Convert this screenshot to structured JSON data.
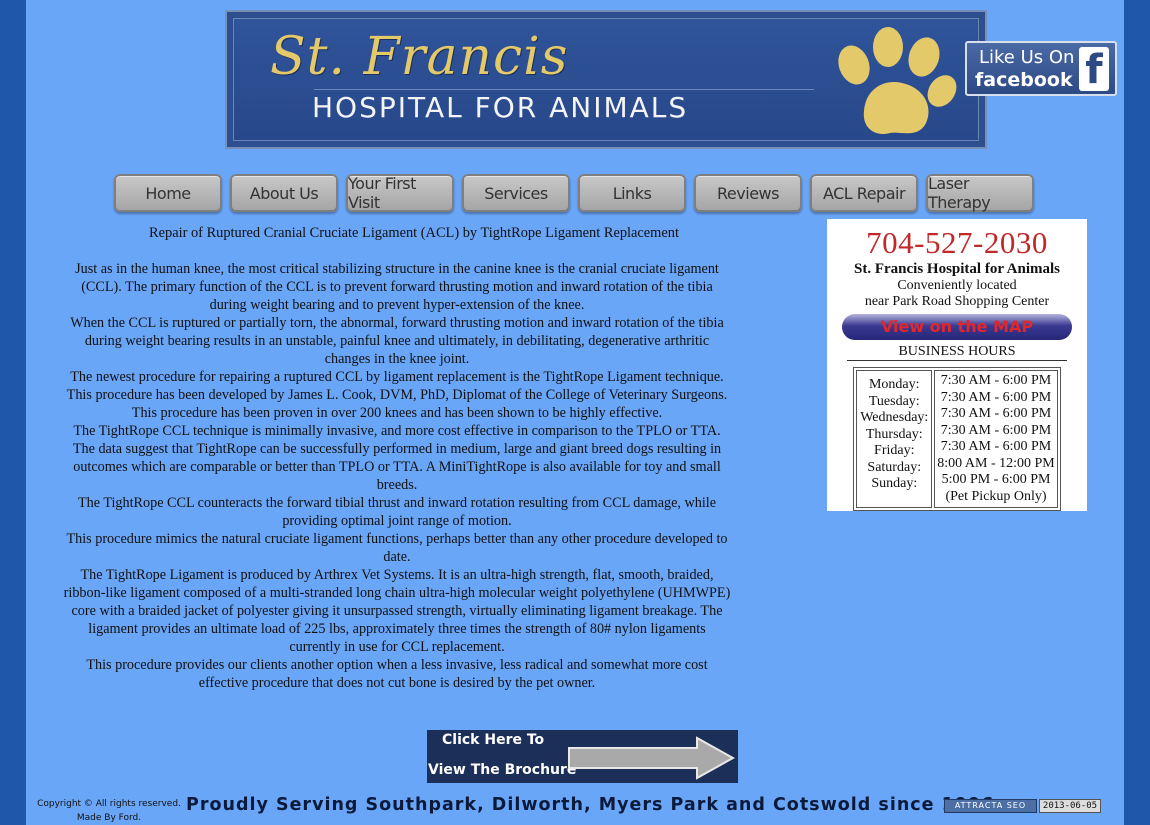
{
  "header": {
    "title": "St. Francis",
    "subtitle": "HOSPITAL FOR ANIMALS",
    "logo_icon": "paw-print-icon",
    "brand_color": "#e4c96a",
    "banner_color": "#2e4f8f"
  },
  "facebook": {
    "line1": "Like Us On",
    "line2": "facebook",
    "icon": "facebook-f-icon"
  },
  "nav": [
    {
      "label": "Home"
    },
    {
      "label": "About Us"
    },
    {
      "label": "Your First Visit"
    },
    {
      "label": "Services"
    },
    {
      "label": "Links"
    },
    {
      "label": "Reviews"
    },
    {
      "label": "ACL Repair"
    },
    {
      "label": "Laser Therapy"
    }
  ],
  "article": {
    "heading": "Repair of Ruptured Cranial Cruciate Ligament (ACL) by TightRope Ligament Replacement",
    "paragraphs": [
      "Just as in the human knee, the most critical stabilizing structure in the canine knee is the cranial cruciate ligament (CCL). The primary function of the CCL is to prevent forward thrusting motion and inward rotation of the tibia during weight bearing and to prevent hyper-extension of the knee.",
      "When the CCL is ruptured or partially torn, the abnormal, forward thrusting motion and inward rotation of the tibia during weight bearing results in an unstable, painful knee and ultimately, in debilitating, degenerative arthritic changes in the knee joint.",
      "The newest procedure for repairing a ruptured CCL by ligament replacement is the TightRope Ligament technique. This procedure has been developed by James L. Cook, DVM, PhD, Diplomat of the College of Veterinary Surgeons. This procedure has been proven in over 200 knees and has been shown to be highly effective.",
      "The TightRope CCL technique is minimally invasive, and more cost effective in comparison to the TPLO or TTA. The data suggest that TightRope can be successfully performed in medium, large and giant breed dogs resulting in outcomes which are comparable or better than TPLO or TTA. A MiniTightRope is also available for toy and small breeds.",
      "The TightRope CCL counteracts the forward tibial thrust and inward rotation resulting from CCL damage, while providing optimal joint range of motion.",
      "This procedure mimics the natural cruciate ligament functions, perhaps better than any other procedure developed to date.",
      "The TightRope Ligament is produced by Arthrex Vet Systems. It is an ultra-high strength, flat, smooth, braided, ribbon-like ligament composed of a multi-stranded long chain ultra-high molecular weight polyethylene (UHMWPE) core with a braided jacket of polyester giving it unsurpassed strength, virtually eliminating ligament breakage. The ligament provides an ultimate load of 225 lbs, approximately three times the strength of 80# nylon ligaments currently in use for CCL replacement.",
      "This procedure provides our clients another option when a less invasive, less radical and somewhat more cost effective procedure that does not cut bone is desired by the pet owner."
    ]
  },
  "card": {
    "phone": "704-527-2030",
    "name": "St. Francis Hospital for Animals",
    "location_line1": "Conveniently located",
    "location_line2": "near Park Road Shopping Center",
    "map_button": "View on the MAP",
    "hours_title": "BUSINESS HOURS",
    "days": [
      "Monday:",
      "Tuesday:",
      "Wednesday:",
      "Thursday:",
      "Friday:",
      "Saturday:",
      "Sunday:"
    ],
    "times": [
      "7:30 AM - 6:00 PM",
      "7:30 AM - 6:00 PM",
      "7:30 AM - 6:00 PM",
      "7:30 AM - 6:00 PM",
      "7:30 AM - 6:00 PM",
      "8:00 AM - 12:00 PM",
      "5:00 PM - 6:00 PM",
      "(Pet Pickup Only)"
    ]
  },
  "brochure": {
    "line1": "Click Here To",
    "line2": "View The Brochure"
  },
  "footer": {
    "copyright": "Copyright © All rights reserved.",
    "made_by": "Made By Ford.",
    "slogan": "Proudly Serving Southpark, Dilworth, Myers Park and Cotswold since 1996",
    "badge_label": "ATTRACTA SEO",
    "badge_date": "2013-06-05"
  }
}
